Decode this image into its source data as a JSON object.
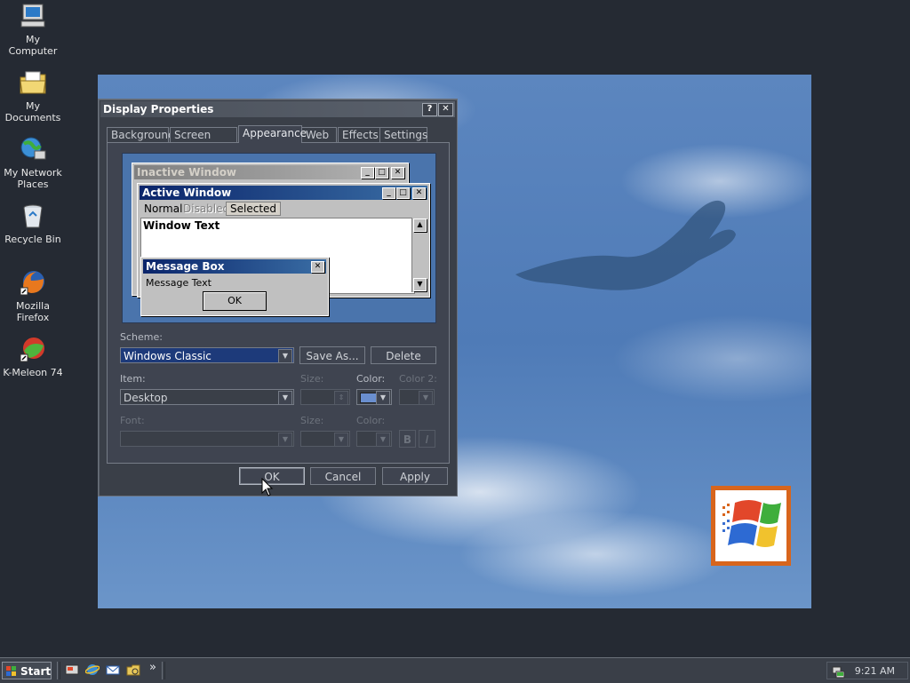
{
  "desktop_icons": [
    {
      "label": "My Computer",
      "icon": "my-computer-icon"
    },
    {
      "label": "My Documents",
      "icon": "my-documents-icon"
    },
    {
      "label": "My Network Places",
      "icon": "network-places-icon"
    },
    {
      "label": "Recycle Bin",
      "icon": "recycle-bin-icon"
    },
    {
      "label": "Mozilla Firefox",
      "icon": "firefox-icon"
    },
    {
      "label": "K-Meleon 74",
      "icon": "k-meleon-icon"
    }
  ],
  "dialog": {
    "title": "Display Properties",
    "help_btn": "?",
    "close_btn": "✕",
    "tabs": [
      "Background",
      "Screen Saver",
      "Appearance",
      "Web",
      "Effects",
      "Settings"
    ],
    "active_tab": "Appearance",
    "preview": {
      "inactive_title": "Inactive Window",
      "active_title": "Active Window",
      "menu_normal": "Normal",
      "menu_disabled": "Disabled",
      "menu_selected": "Selected",
      "window_text": "Window Text",
      "msgbox_title": "Message Box",
      "msgbox_text": "Message Text",
      "msgbox_ok": "OK"
    },
    "scheme_label": "Scheme:",
    "scheme_value": "Windows Classic",
    "save_as": "Save As...",
    "delete": "Delete",
    "item_label": "Item:",
    "item_value": "Desktop",
    "size_label": "Size:",
    "color_label": "Color:",
    "color2_label": "Color 2:",
    "font_label": "Font:",
    "font_size_label": "Size:",
    "font_color_label": "Color:",
    "bold_btn": "B",
    "italic_btn": "I",
    "desktop_color": "#6a8fcf",
    "ok": "OK",
    "cancel": "Cancel",
    "apply": "Apply"
  },
  "taskbar": {
    "start_label": "Start",
    "more_label": "»",
    "quick_launch": [
      "show-desktop-icon",
      "internet-explorer-icon",
      "outlook-express-icon",
      "windows-explorer-icon"
    ],
    "time": "9:21 AM"
  }
}
